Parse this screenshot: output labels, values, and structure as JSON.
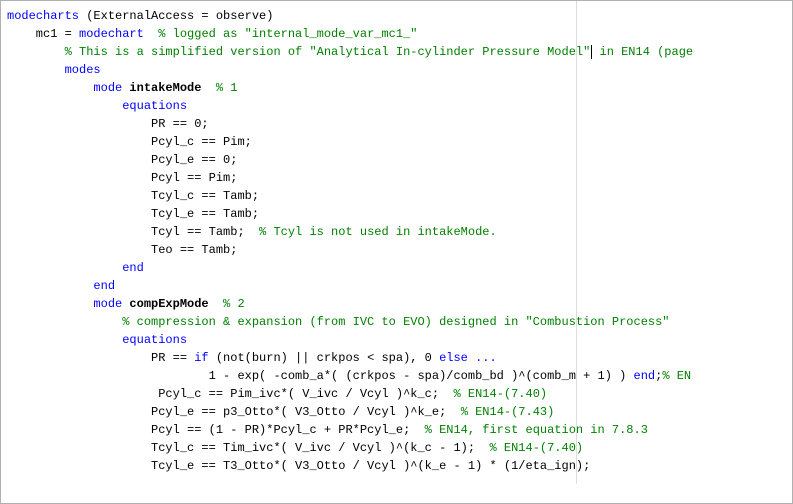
{
  "lines": {
    "l1a": "modecharts",
    "l1b": " (ExternalAccess = observe)",
    "l2a": "    mc1 = ",
    "l2b": "modechart",
    "l2c": "  % logged as \"internal_mode_var_mc1_\"",
    "l3a": "        % This is a simplified version of \"Analytical In-cylinder Pressure Model\"",
    "l3b": " in EN14 (page",
    "l4": "        modes",
    "l5a": "            mode",
    "l5b": " intakeMode  ",
    "l5c": "% 1",
    "l6": "                equations",
    "l7": "                    PR == 0;",
    "l8": "                    Pcyl_c == Pim;",
    "l9": "                    Pcyl_e == 0;",
    "l10": "                    Pcyl == Pim;",
    "l11": "                    Tcyl_c == Tamb;",
    "l12": "                    Tcyl_e == Tamb;",
    "l13a": "                    Tcyl == Tamb;  ",
    "l13b": "% Tcyl is not used in intakeMode.",
    "l14": "                    Teo == Tamb;",
    "l15": "                end",
    "l16": "            end",
    "l17a": "            mode",
    "l17b": " compExpMode  ",
    "l17c": "% 2",
    "l18": "                % compression & expansion (from IVC to EVO) designed in \"Combustion Process\"",
    "l19": "                equations",
    "l20a": "                    PR == ",
    "l20b": "if",
    "l20c": " (not(burn) || crkpos < spa), 0 ",
    "l20d": "else",
    "l20e": " ...",
    "l21a": "                            1 - exp( -comb_a*( (crkpos - spa)/comb_bd )^(comb_m + 1) ) ",
    "l21b": "end",
    "l21c": ";",
    "l21d": "% EN",
    "l22a": "                     Pcyl_c == Pim_ivc*( V_ivc / Vcyl )^k_c;  ",
    "l22b": "% EN14-(7.40)",
    "l23a": "                    Pcyl_e == p3_Otto*( V3_Otto / Vcyl )^k_e;  ",
    "l23b": "% EN14-(7.43)",
    "l24a": "                    Pcyl == (1 - PR)*Pcyl_c + PR*Pcyl_e;  ",
    "l24b": "% EN14, first equation in 7.8.3",
    "l25a": "                    Tcyl_c == Tim_ivc*( V_ivc / Vcyl )^(k_c - 1);  ",
    "l25b": "% EN14-(7.40)",
    "l26": "                    Tcyl_e == T3_Otto*( V3_Otto / Vcyl )^(k_e - 1) * (1/eta_ign);"
  }
}
